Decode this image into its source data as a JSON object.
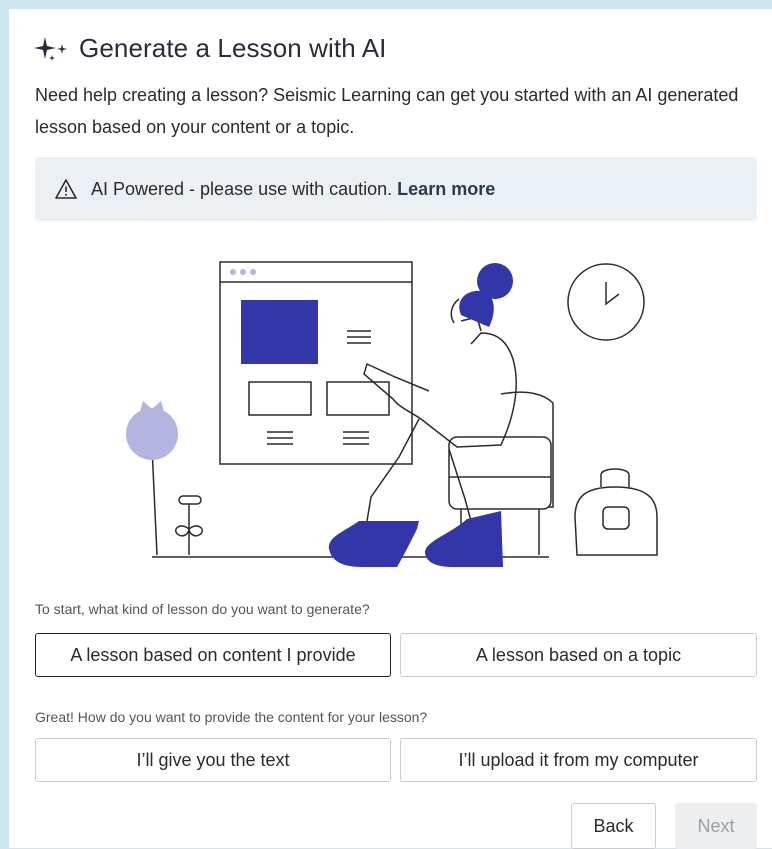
{
  "header": {
    "title": "Generate a Lesson with AI",
    "icon": "sparkles-icon"
  },
  "description": "Need help creating a lesson? Seismic Learning can get you started with an AI generated lesson based on your content or a topic.",
  "banner": {
    "icon": "warning-icon",
    "text": "AI Powered - please use with caution.",
    "link": "Learn more"
  },
  "colors": {
    "accent": "#3336a8",
    "lavender": "#b3b4e0",
    "page_bg": "#cfe6ee",
    "banner_bg": "#eaf0f4"
  },
  "lesson_type": {
    "question": "To start, what kind of lesson do you want to generate?",
    "options": [
      "A lesson based on content I provide",
      "A lesson based on a topic"
    ],
    "selected": "A lesson based on content I provide"
  },
  "content_source": {
    "question": "Great! How do you want to provide the content for your lesson?",
    "options": [
      "I’ll give you the text",
      "I’ll upload it from my computer"
    ]
  },
  "footer": {
    "back_label": "Back",
    "next_label": "Next"
  }
}
